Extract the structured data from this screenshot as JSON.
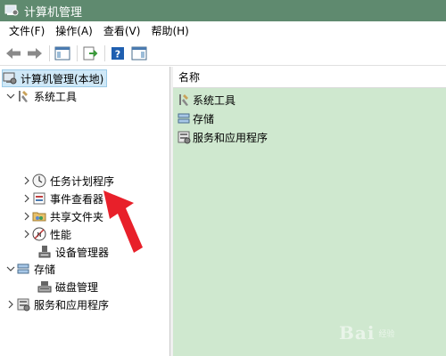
{
  "window": {
    "title": "计算机管理"
  },
  "menu": [
    "文件(F)",
    "操作(A)",
    "查看(V)",
    "帮助(H)"
  ],
  "toolbar": {
    "buttons": [
      "back-icon",
      "forward-icon",
      "show-hide-tree-icon",
      "export-list-icon",
      "help-icon",
      "show-action-pane-icon"
    ]
  },
  "tree": {
    "root": "计算机管理(本地)",
    "system_tools": "系统工具",
    "task_scheduler": "任务计划程序",
    "event_viewer": "事件查看器",
    "shared_folders": "共享文件夹",
    "performance": "性能",
    "device_manager": "设备管理器",
    "storage": "存储",
    "disk_management": "磁盘管理",
    "services_apps": "服务和应用程序"
  },
  "detail": {
    "column_name": "名称",
    "rows": [
      "系统工具",
      "存储",
      "服务和应用程序"
    ]
  },
  "watermark": {
    "logo": "Bai",
    "sub": "经验"
  },
  "colors": {
    "titlebar": "#5f8a6f",
    "detail_bg": "#cfe8cf",
    "selection": "#cfe8f7",
    "arrow": "#e8202a"
  }
}
